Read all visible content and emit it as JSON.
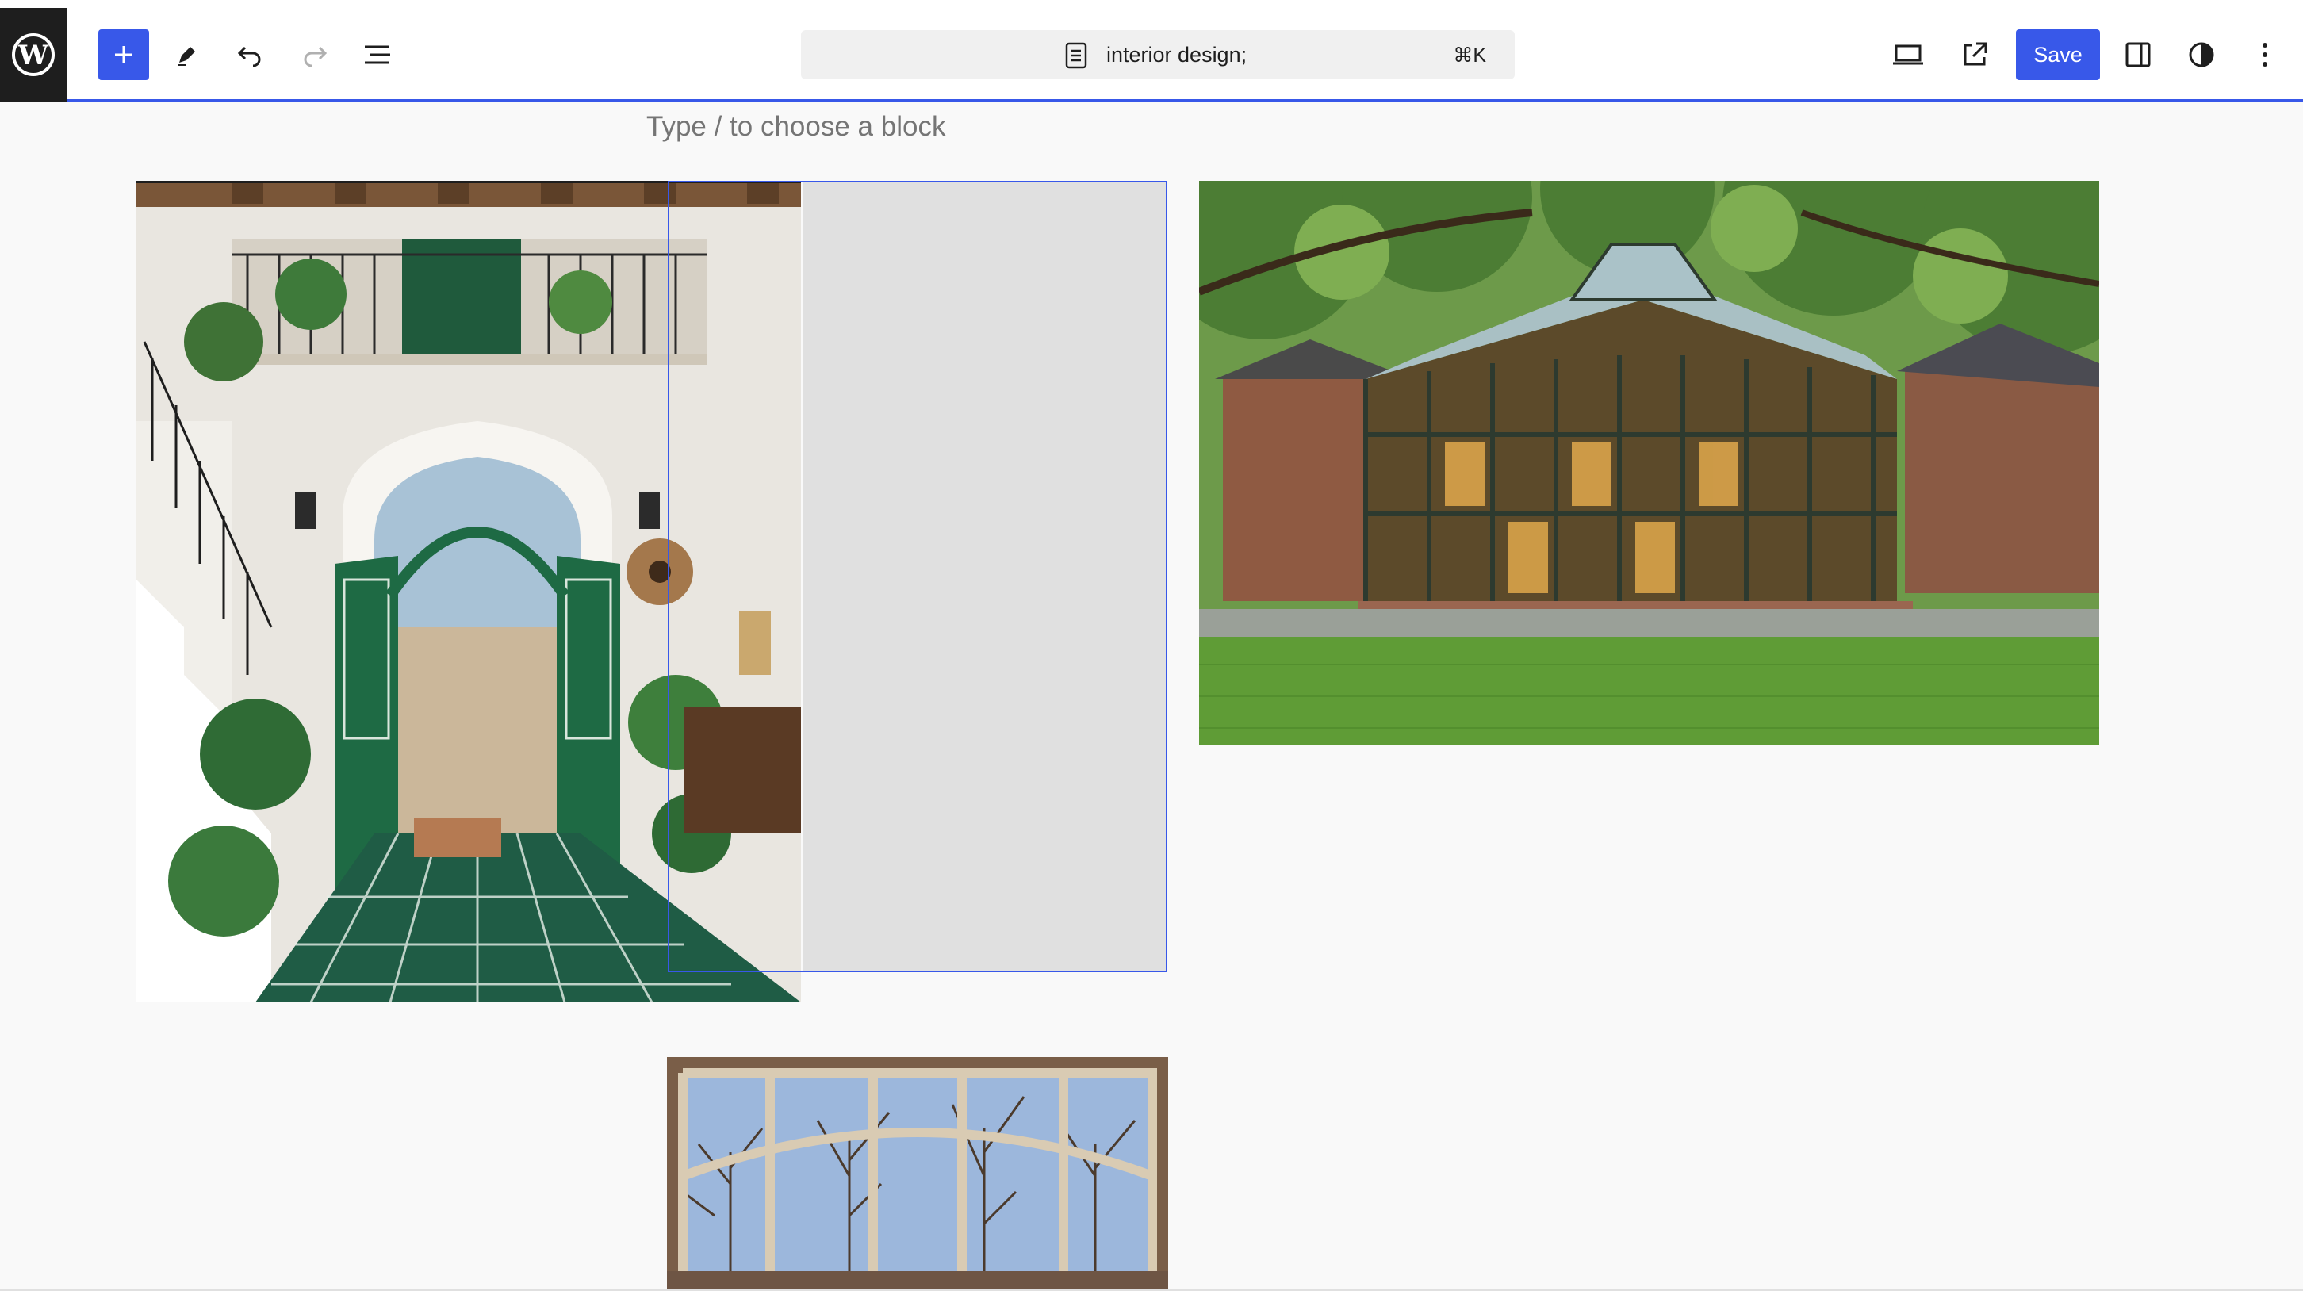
{
  "toolbar": {
    "add_block_label": "Add block",
    "command_bar": {
      "title": "interior design;",
      "shortcut": "⌘K"
    },
    "save_label": "Save",
    "icons": [
      "wordpress-logo",
      "plus-icon",
      "pencil-icon",
      "undo-icon",
      "redo-icon",
      "list-view-icon",
      "document-icon",
      "desktop-view-icon",
      "external-link-icon",
      "sidebar-toggle-icon",
      "styles-contrast-icon",
      "more-options-icon"
    ]
  },
  "editor": {
    "placeholder": "Type / to choose a block"
  },
  "colors": {
    "accent": "#3858e9",
    "toolbar_bg": "#ffffff",
    "canvas_bg": "#f9f9f9",
    "logo_bg": "#1e1e1e",
    "drop_zone": "#e0e0e0"
  }
}
